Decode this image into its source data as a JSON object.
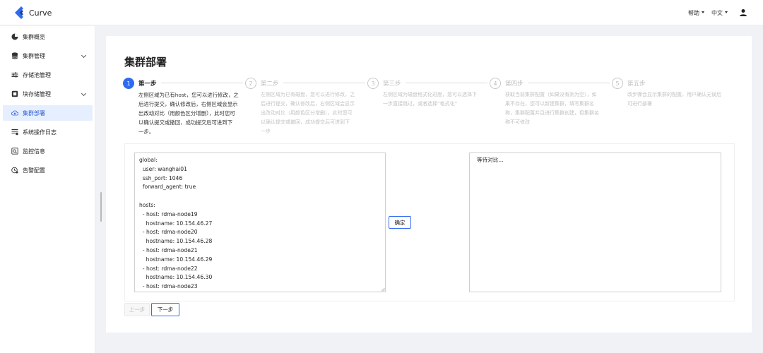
{
  "app": {
    "name": "Curve",
    "brand_color": "#2f6bf0"
  },
  "header": {
    "help_label": "帮助",
    "lang_label": "中文",
    "user_icon": "user-icon"
  },
  "sidebar": {
    "items": [
      {
        "label": "集群概览",
        "icon": "pie-chart-icon",
        "expandable": false,
        "active": false
      },
      {
        "label": "集群管理",
        "icon": "database-icon",
        "expandable": true,
        "active": false
      },
      {
        "label": "存储池管理",
        "icon": "sliders-icon",
        "expandable": false,
        "active": false
      },
      {
        "label": "块存储管理",
        "icon": "block-storage-icon",
        "expandable": true,
        "active": false
      },
      {
        "label": "集群部署",
        "icon": "cloud-deploy-icon",
        "expandable": false,
        "active": true
      },
      {
        "label": "系统操作日志",
        "icon": "log-icon",
        "expandable": false,
        "active": false
      },
      {
        "label": "监控信息",
        "icon": "monitor-icon",
        "expandable": false,
        "active": false
      },
      {
        "label": "告警配置",
        "icon": "alarm-icon",
        "expandable": false,
        "active": false
      }
    ]
  },
  "main": {
    "title": "集群部署",
    "steps": [
      {
        "num": "1",
        "title": "第一步",
        "active": true,
        "desc": [
          "左侧区域为已有host，您可以进行修改，之",
          "后进行提交，确认修改后，右侧区域会显示",
          "出改动对比（用颜色区分增删），此时您可",
          "以确认提交或撤回，成功提交后可进到下",
          "一步。"
        ]
      },
      {
        "num": "2",
        "title": "第二步",
        "active": false,
        "desc": [
          "左侧区域为已有磁盘，您可以进行修改，之",
          "后进行提交，确认修改后，右侧区域会显示",
          "出改动对比（用颜色区分增删），此时您可",
          "以确认提交或撤回，成功提交后可进到下",
          "一步"
        ]
      },
      {
        "num": "3",
        "title": "第三步",
        "active": false,
        "desc": [
          "左侧区域为磁盘格式化进度，您可以选择下",
          "一步直接跳过，或者选择“格式化”"
        ]
      },
      {
        "num": "4",
        "title": "第四步",
        "active": false,
        "desc": [
          "获取当前集群配置（如果没有则为空），如",
          "果不存在，您可以新建集群，填写集群名",
          "称，集群配置并且进行集群创建，但集群名",
          "称不可修改"
        ]
      },
      {
        "num": "5",
        "title": "第五步",
        "active": false,
        "desc": [
          "改步骤会显示集群的配置，用户确认无误后",
          "可进行部署"
        ]
      }
    ],
    "editor_text": "global:\n  user: wanghai01\n  ssh_port: 1046\n  forward_agent: true\n\nhosts:\n  - host: rdma-node19\n    hostname: 10.154.46.27\n  - host: rdma-node20\n    hostname: 10.154.46.28\n  - host: rdma-node21\n    hostname: 10.154.46.29\n  - host: rdma-node22\n    hostname: 10.154.46.30\n  - host: rdma-node23",
    "confirm_label": "确定",
    "diff_placeholder": "等待对比...",
    "prev_label": "上一步",
    "next_label": "下一步"
  }
}
